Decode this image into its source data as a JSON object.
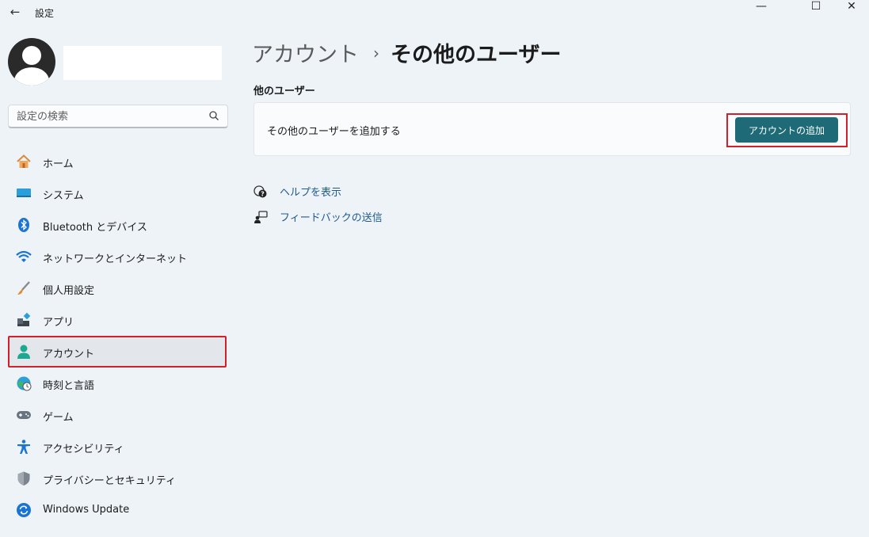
{
  "window": {
    "back_glyph": "←",
    "title": "設定",
    "minimize_glyph": "—",
    "maximize_glyph": "☐",
    "close_glyph": "✕"
  },
  "search": {
    "placeholder": "設定の検索"
  },
  "sidebar": {
    "items": [
      {
        "label": "ホーム",
        "icon": "home-icon"
      },
      {
        "label": "システム",
        "icon": "monitor-icon"
      },
      {
        "label": "Bluetooth とデバイス",
        "icon": "bluetooth-icon"
      },
      {
        "label": "ネットワークとインターネット",
        "icon": "wifi-icon"
      },
      {
        "label": "個人用設定",
        "icon": "brush-icon"
      },
      {
        "label": "アプリ",
        "icon": "apps-icon"
      },
      {
        "label": "アカウント",
        "icon": "person-icon",
        "active": true
      },
      {
        "label": "時刻と言語",
        "icon": "globe-clock-icon"
      },
      {
        "label": "ゲーム",
        "icon": "gamepad-icon"
      },
      {
        "label": "アクセシビリティ",
        "icon": "accessibility-icon"
      },
      {
        "label": "プライバシーとセキュリティ",
        "icon": "shield-icon"
      },
      {
        "label": "Windows Update",
        "icon": "update-icon"
      }
    ]
  },
  "main": {
    "breadcrumb_parent": "アカウント",
    "breadcrumb_separator": "›",
    "breadcrumb_current": "その他のユーザー",
    "section_title": "他のユーザー",
    "card_label": "その他のユーザーを追加する",
    "add_button_label": "アカウントの追加",
    "links": [
      {
        "label": "ヘルプを表示",
        "icon": "help-icon"
      },
      {
        "label": "フィードバックの送信",
        "icon": "feedback-icon"
      }
    ]
  },
  "colors": {
    "accent_button": "#1e6b77",
    "highlight_border": "#d1202a",
    "link_text": "#1f5a8c",
    "background": "#eef3f8"
  }
}
